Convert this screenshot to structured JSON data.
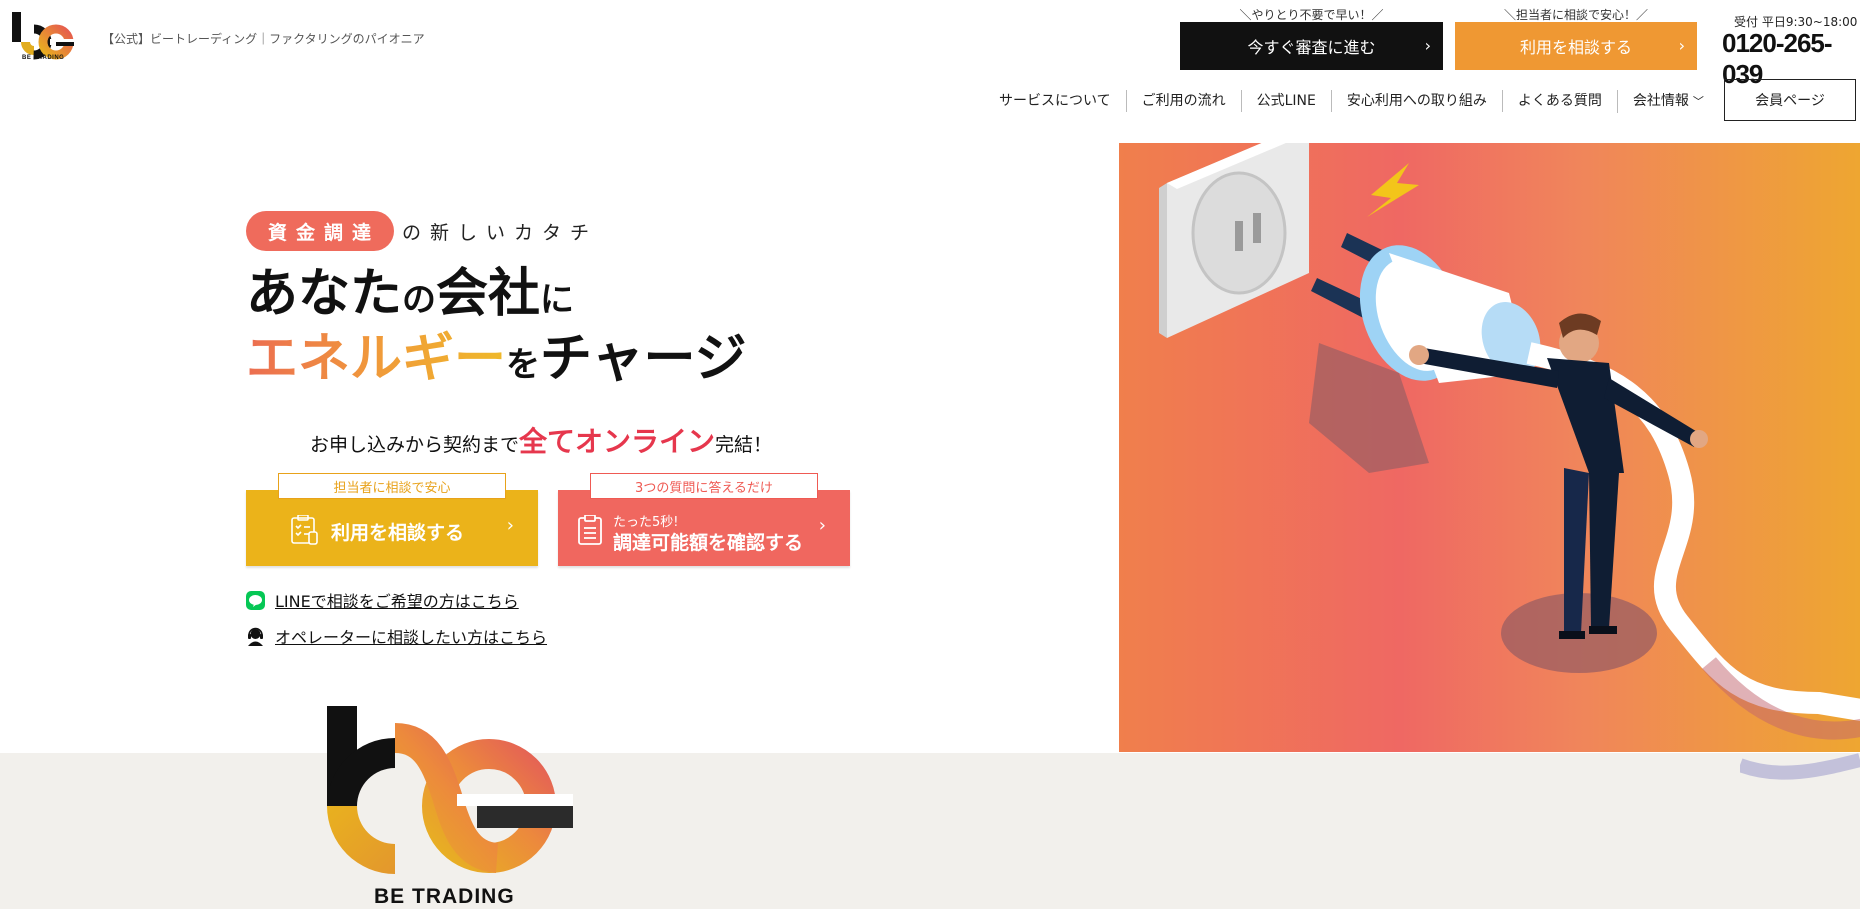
{
  "header": {
    "logo_text": "BE TRADING",
    "caption": "【公式】ビートレーディング｜ファクタリングのパイオニア",
    "cta_review": {
      "note": "＼やりとり不要で早い！／",
      "label": "今すぐ審査に進む"
    },
    "cta_consult": {
      "note": "＼担当者に相談で安心！／",
      "label": "利用を相談する"
    },
    "phone_hours": "受付 平日9:30~18:00",
    "phone_number": "0120-265-039"
  },
  "nav": {
    "items": [
      "サービスについて",
      "ご利用の流れ",
      "公式LINE",
      "安心利用への取り組み",
      "よくある質問",
      "会社情報"
    ],
    "member_button": "会員ページ"
  },
  "hero": {
    "tag": "資金調達",
    "tag_suffix": "の新しいカタチ",
    "headline1_a": "あなた",
    "headline1_b": "の",
    "headline1_c": "会社",
    "headline1_d": "に",
    "headline2_a": "エネルギー",
    "headline2_b": "を",
    "headline2_c": "チャージ",
    "online_a": "お申し込みから契約まで",
    "online_b": "全てオンライン",
    "online_c": "完結！",
    "cta_consult": {
      "tab": "担当者に相談で安心",
      "label": "利用を相談する"
    },
    "cta_check": {
      "tab": "3つの質問に答えるだけ",
      "small": "たった5秒!",
      "label": "調達可能額を確認する"
    },
    "link_line": "LINEで相談をご希望の方はこちら",
    "link_operator": "オペレーターに相談したい方はこちら",
    "brand_text": "BE TRADING"
  },
  "icons": [
    "logo-icon",
    "chevron-right-icon",
    "chevron-down-icon",
    "checklist-icon",
    "clipboard-icon",
    "line-icon",
    "operator-icon"
  ],
  "colors": {
    "accent_orange": "#ef9833",
    "accent_yellow": "#ebb31a",
    "accent_coral": "#f0675f",
    "accent_red": "#e6374d",
    "dark": "#111111"
  }
}
